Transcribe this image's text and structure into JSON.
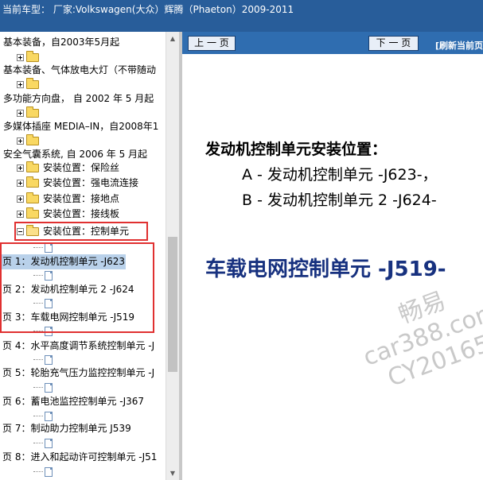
{
  "titlebar": {
    "text": "当前车型：  厂家:Volkswagen(大众）辉腾（Phaeton）2009-2011"
  },
  "tree": {
    "rows": [
      {
        "label": "基本装备，自2003年5月起",
        "kind": "branch"
      },
      {
        "label": "",
        "kind": "folder-closed"
      },
      {
        "label": "基本装备、气体放电大灯（不带随动",
        "kind": "branch"
      },
      {
        "label": "",
        "kind": "folder-closed"
      },
      {
        "label": "多功能方向盘， 自 2002 年 5 月起",
        "kind": "branch"
      },
      {
        "label": "",
        "kind": "folder-closed"
      },
      {
        "label": "多媒体插座 MEDIA–IN，自2008年1",
        "kind": "branch"
      },
      {
        "label": "",
        "kind": "folder-closed"
      },
      {
        "label": "安全气囊系统, 自 2006 年 5 月起",
        "kind": "branch"
      },
      {
        "label": "安装位置：保险丝",
        "kind": "folder-closed"
      },
      {
        "label": "安装位置：强电流连接",
        "kind": "folder-closed"
      },
      {
        "label": "安装位置：接地点",
        "kind": "folder-closed"
      },
      {
        "label": "安装位置：接线板",
        "kind": "folder-closed"
      },
      {
        "label": "安装位置：控制单元",
        "kind": "folder-open"
      },
      {
        "label": "",
        "kind": "doc"
      },
      {
        "label": "页 1：发动机控制单元 -J623",
        "kind": "page",
        "selected": true
      },
      {
        "label": "",
        "kind": "doc"
      },
      {
        "label": "页 2：发动机控制单元 2 -J624",
        "kind": "page"
      },
      {
        "label": "",
        "kind": "doc"
      },
      {
        "label": "页 3：车载电网控制单元 -J519",
        "kind": "page"
      },
      {
        "label": "",
        "kind": "doc"
      },
      {
        "label": "页 4：水平高度调节系统控制单元 -J",
        "kind": "page"
      },
      {
        "label": "",
        "kind": "doc"
      },
      {
        "label": "页 5：轮胎充气压力监控控制单元 -J",
        "kind": "page"
      },
      {
        "label": "",
        "kind": "doc"
      },
      {
        "label": "页 6：蓄电池监控控制单元 -J367",
        "kind": "page"
      },
      {
        "label": "",
        "kind": "doc"
      },
      {
        "label": "页 7：制动助力控制单元 J539",
        "kind": "page"
      },
      {
        "label": "",
        "kind": "doc"
      },
      {
        "label": "页 8：进入和起动许可控制单元 -J51",
        "kind": "page"
      }
    ]
  },
  "nav": {
    "prev_label": "上 一 页",
    "next_label": "下 一 页",
    "refresh_label": "[刷新当前页"
  },
  "content": {
    "heading": "发动机控制单元安装位置：",
    "items": [
      "A - 发动机控制单元 -J623-，",
      "B - 发动机控制单元 2 -J624-"
    ],
    "title2": "车载电网控制单元 -J519-"
  },
  "watermark": {
    "line1": "畅易",
    "line2": "car388.com",
    "line3": "CY20165"
  },
  "colors": {
    "titlebar_bg": "#285d9a",
    "nav_bg": "#2f6db0",
    "highlight_border": "#e03030",
    "title2_color": "#17317f",
    "selection_bg": "#b9d1ea"
  },
  "icons": {
    "expand": "plus-box-icon",
    "collapse": "minus-box-icon",
    "folder": "folder-icon",
    "document": "document-icon"
  }
}
